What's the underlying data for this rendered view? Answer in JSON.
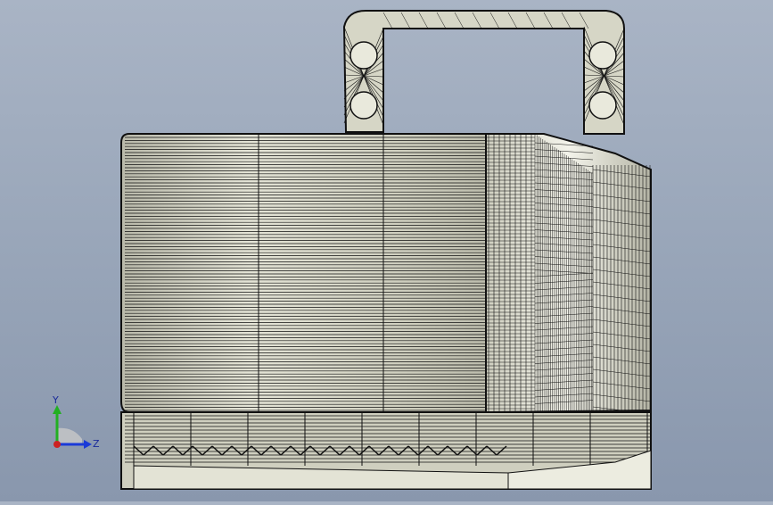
{
  "viewport": {
    "background_top": "#a9b4c5",
    "background_bottom": "#8997ad"
  },
  "model": {
    "body_color": "#d8d8c8",
    "wire_color": "#111111",
    "highlight_color": "#f2f2e6",
    "shadow_color": "#9c9c8c"
  },
  "triad": {
    "y_label": "Y",
    "z_label": "Z",
    "y_color": "#22b022",
    "z_color": "#1a3ad8",
    "x_color": "#d82020",
    "origin_color": "#cc2222"
  }
}
